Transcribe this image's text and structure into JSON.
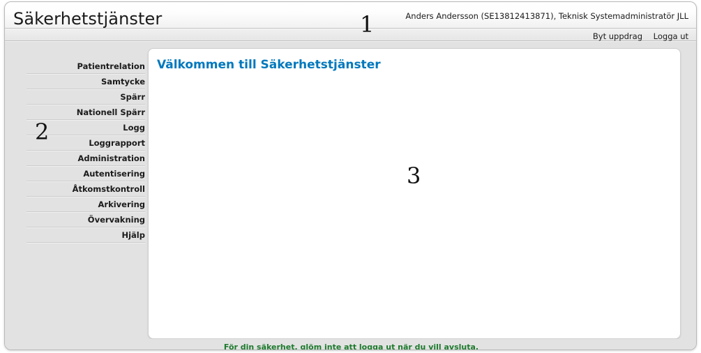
{
  "app": {
    "title": "Säkerhetstjänster"
  },
  "header": {
    "user_info": "Anders Andersson (SE13812413871), Teknisk Systemadministratör JLL",
    "links": [
      {
        "label": "Byt uppdrag",
        "name": "byt-uppdrag-link"
      },
      {
        "label": "Logga ut",
        "name": "logga-ut-link"
      }
    ]
  },
  "sidebar": {
    "items": [
      {
        "label": "Patientrelation"
      },
      {
        "label": "Samtycke"
      },
      {
        "label": "Spärr"
      },
      {
        "label": "Nationell Spärr"
      },
      {
        "label": "Logg"
      },
      {
        "label": "Loggrapport"
      },
      {
        "label": "Administration"
      },
      {
        "label": "Autentisering"
      },
      {
        "label": "Åtkomstkontroll"
      },
      {
        "label": "Arkivering"
      },
      {
        "label": "Övervakning"
      },
      {
        "label": "Hjälp"
      }
    ]
  },
  "main": {
    "title": "Välkommen till Säkerhetstjänster"
  },
  "footer": {
    "text": "För din säkerhet, glöm inte att logga ut när du vill avsluta."
  },
  "annotations": [
    {
      "label": "1"
    },
    {
      "label": "2"
    },
    {
      "label": "3"
    }
  ],
  "colors": {
    "accent": "#0078bd",
    "footer_green": "#1d7a2d",
    "page_background": "#e2e2e2",
    "panel_background": "#ffffff"
  }
}
